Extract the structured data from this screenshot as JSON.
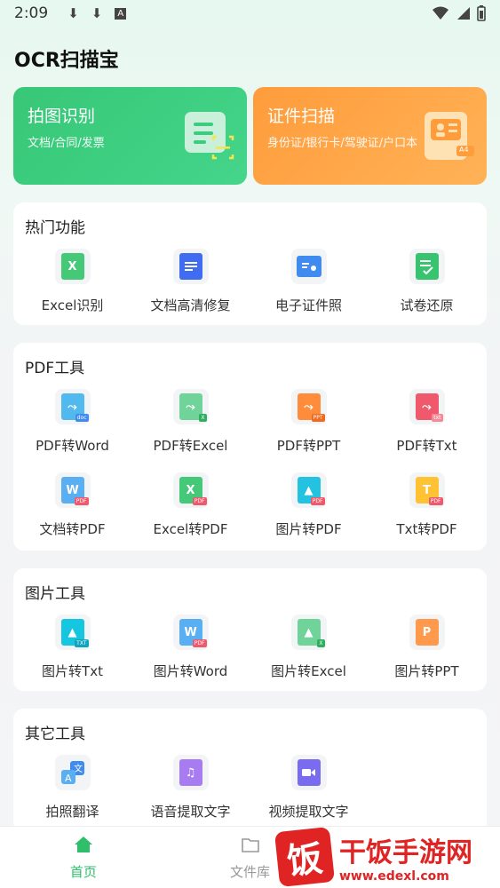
{
  "status_bar": {
    "time": "2:09",
    "icons": [
      "download-icon",
      "download-icon",
      "font-icon"
    ],
    "right_icons": [
      "wifi-icon",
      "signal-icon",
      "battery-icon"
    ]
  },
  "app": {
    "title": "OCR扫描宝"
  },
  "hero": {
    "photo_recognize": {
      "title": "拍图识别",
      "subtitle": "文档/合同/发票",
      "color": "#3ccb7f"
    },
    "id_scan": {
      "title": "证件扫描",
      "subtitle": "身份证/银行卡/驾驶证/户口本",
      "badge": "A4",
      "color": "#ffa447"
    }
  },
  "hot": {
    "title": "热门功能",
    "items": [
      {
        "label": "Excel识别",
        "icon": "excel-icon"
      },
      {
        "label": "文档高清修复",
        "icon": "document-icon"
      },
      {
        "label": "电子证件照",
        "icon": "id-photo-icon"
      },
      {
        "label": "试卷还原",
        "icon": "checklist-icon"
      }
    ]
  },
  "pdf": {
    "title": "PDF工具",
    "items": [
      {
        "label": "PDF转Word",
        "icon": "pdf-to-word-icon"
      },
      {
        "label": "PDF转Excel",
        "icon": "pdf-to-excel-icon"
      },
      {
        "label": "PDF转PPT",
        "icon": "pdf-to-ppt-icon"
      },
      {
        "label": "PDF转Txt",
        "icon": "pdf-to-txt-icon"
      },
      {
        "label": "文档转PDF",
        "icon": "word-to-pdf-icon"
      },
      {
        "label": "Excel转PDF",
        "icon": "excel-to-pdf-icon"
      },
      {
        "label": "图片转PDF",
        "icon": "image-to-pdf-icon"
      },
      {
        "label": "Txt转PDF",
        "icon": "txt-to-pdf-icon"
      }
    ]
  },
  "image": {
    "title": "图片工具",
    "items": [
      {
        "label": "图片转Txt",
        "icon": "image-to-txt-icon"
      },
      {
        "label": "图片转Word",
        "icon": "image-to-word-icon"
      },
      {
        "label": "图片转Excel",
        "icon": "image-to-excel-icon"
      },
      {
        "label": "图片转PPT",
        "icon": "image-to-ppt-icon"
      }
    ]
  },
  "other": {
    "title": "其它工具",
    "items": [
      {
        "label": "拍照翻译",
        "icon": "translate-icon"
      },
      {
        "label": "语音提取文字",
        "icon": "audio-icon"
      },
      {
        "label": "视频提取文字",
        "icon": "video-icon"
      }
    ]
  },
  "nav": {
    "home": "首页",
    "files": "文件库"
  },
  "watermark": {
    "glyph": "饭",
    "title": "干饭手游网",
    "url": "www.edexl.com"
  },
  "colors": {
    "accent": "#2fbf6b",
    "brand_red": "#e02424"
  }
}
